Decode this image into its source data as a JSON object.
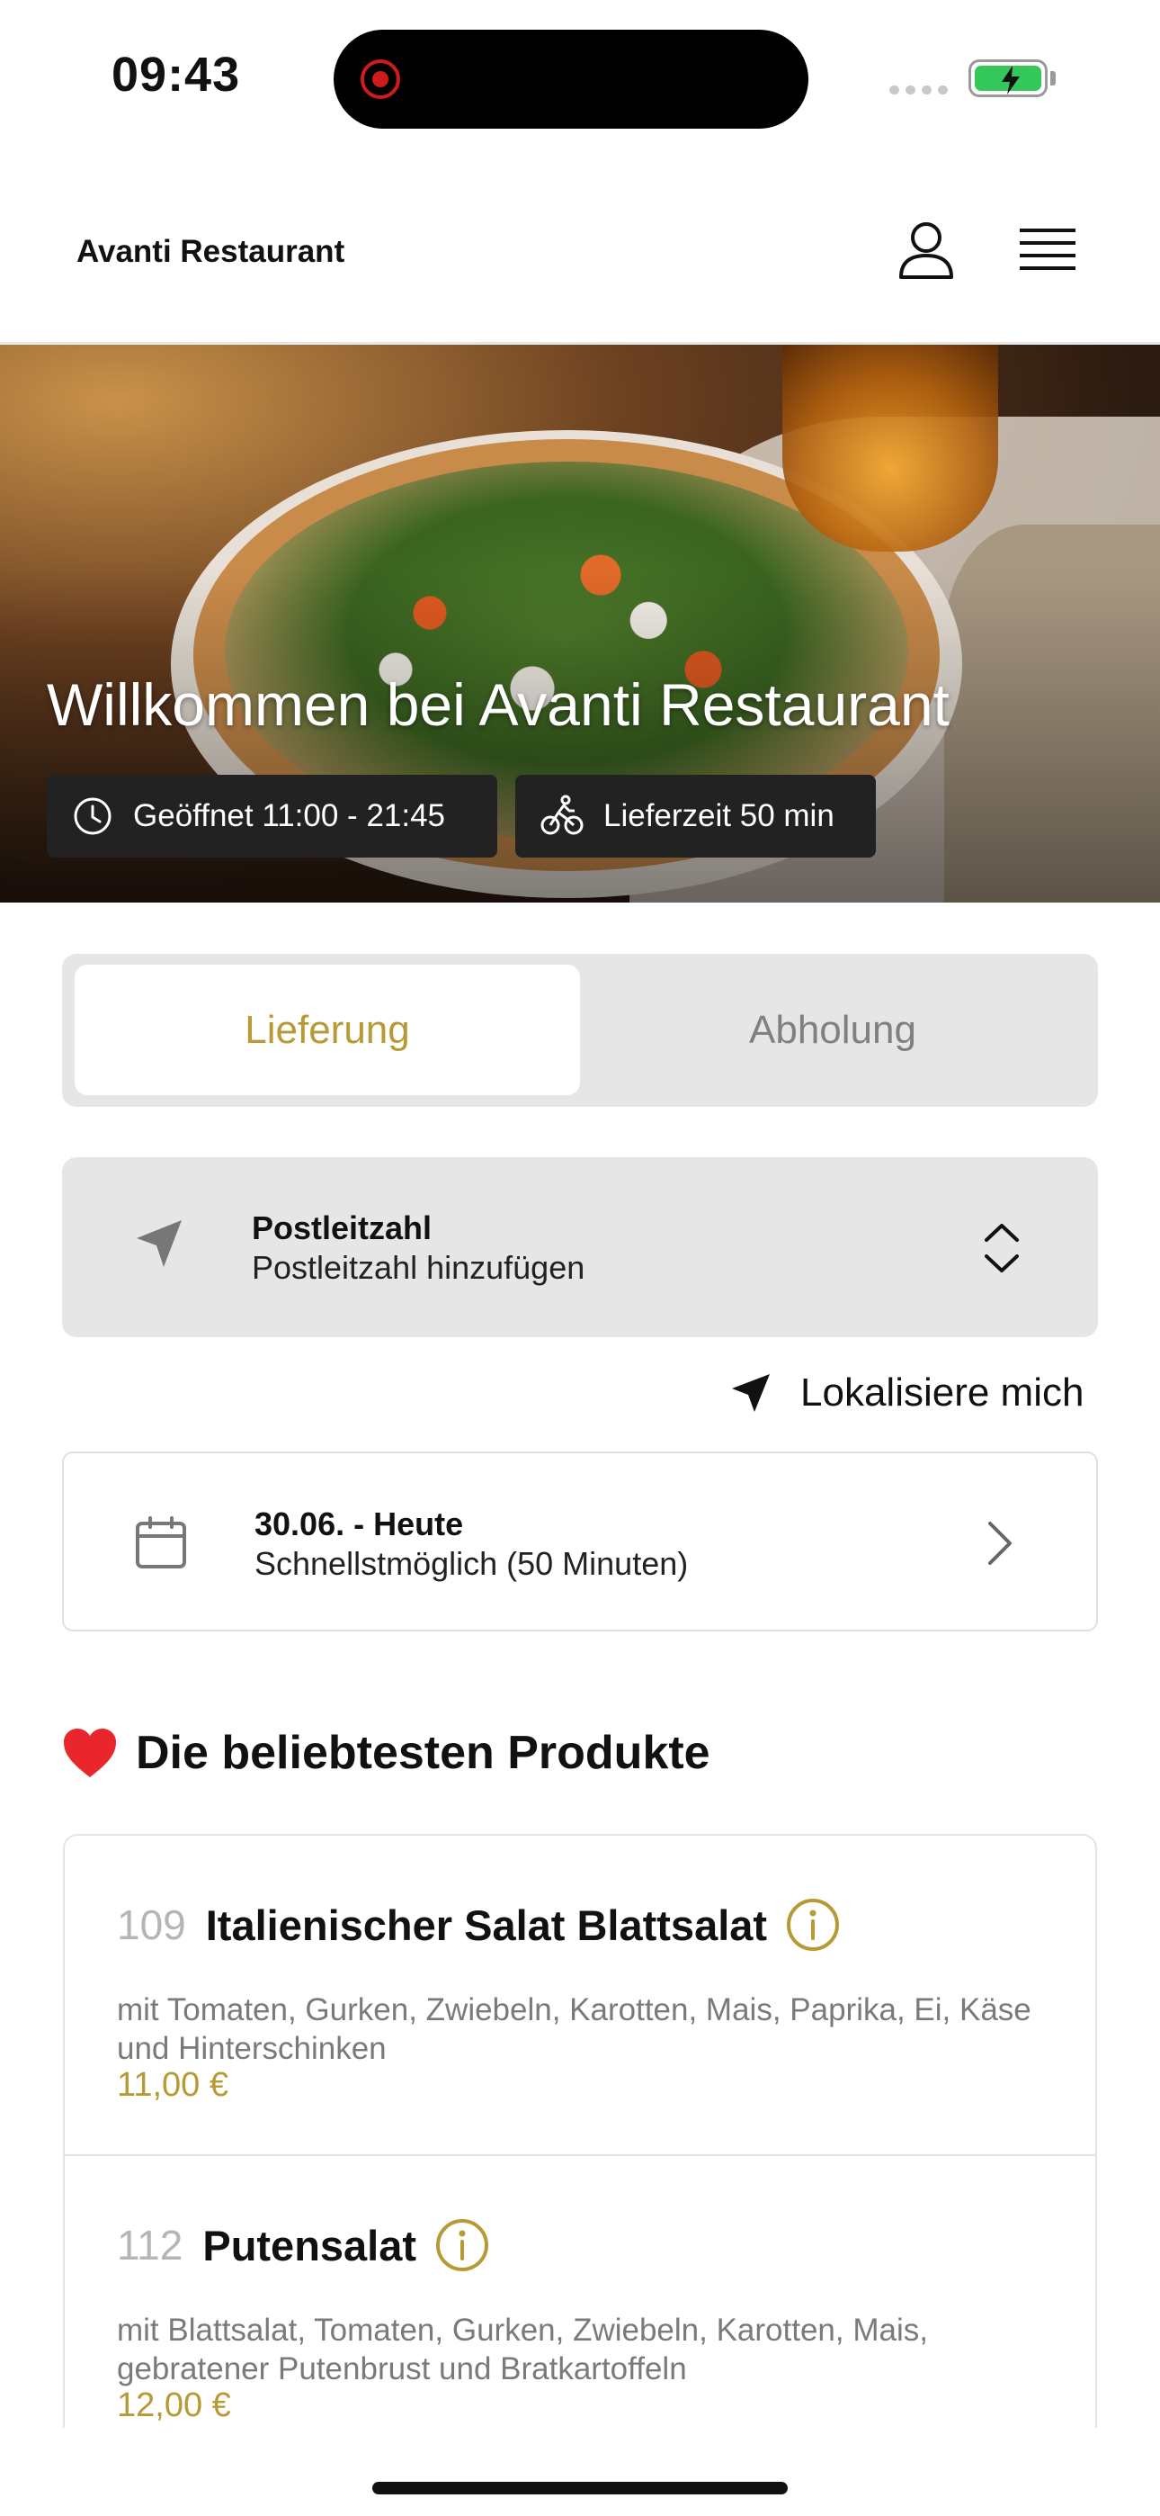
{
  "status_bar": {
    "time": "09:43"
  },
  "header": {
    "title": "Avanti Restaurant",
    "user_icon": "user-icon",
    "menu_icon": "hamburger-menu-icon"
  },
  "hero": {
    "title": "Willkommen bei Avanti Restaurant",
    "opening_hours": "Geöffnet 11:00 - 21:45",
    "delivery_time": "Lieferzeit 50 min"
  },
  "tabs": [
    {
      "label": "Lieferung",
      "active": true
    },
    {
      "label": "Abholung",
      "active": false
    }
  ],
  "postcode": {
    "label": "Postleitzahl",
    "value": "Postleitzahl hinzufügen"
  },
  "locate": {
    "label": "Lokalisiere mich"
  },
  "date": {
    "label": "30.06. - Heute",
    "value": "Schnellstmöglich (50 Minuten)"
  },
  "popular": {
    "title": "Die beliebtesten Produkte",
    "products": [
      {
        "number": "109",
        "name": "Italienischer Salat Blattsalat",
        "description": "mit Tomaten, Gurken, Zwiebeln, Karotten, Mais, Paprika, Ei, Käse und Hinterschinken",
        "price": "11,00 €"
      },
      {
        "number": "112",
        "name": "Putensalat",
        "description": "mit Blattsalat, Tomaten, Gurken, Zwiebeln, Karotten, Mais, gebratener Putenbrust und Bratkartoffeln",
        "price": "12,00 €"
      }
    ]
  },
  "colors": {
    "accent": "#b79a36",
    "chip_bg": "#222222",
    "panel_bg": "#e6e6e6"
  }
}
